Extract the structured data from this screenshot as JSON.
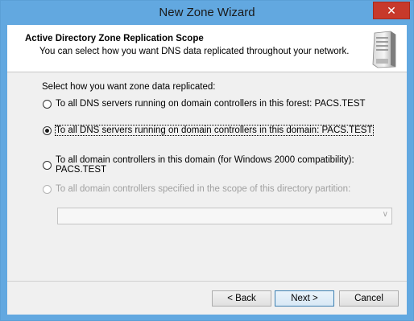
{
  "window": {
    "title": "New Zone Wizard",
    "close_glyph": "✕"
  },
  "header": {
    "title": "Active Directory Zone Replication Scope",
    "subtitle": "You can select how you want DNS data replicated throughout your network.",
    "icon": "server-icon"
  },
  "body": {
    "prompt": "Select how you want zone data replicated:",
    "options": [
      {
        "label": "To all DNS servers running on domain controllers in this forest: PACS.TEST",
        "selected": false,
        "enabled": true
      },
      {
        "label": "To all DNS servers running on domain controllers in this domain: PACS.TEST",
        "selected": true,
        "enabled": true
      },
      {
        "label": "To all domain controllers in this domain (for Windows 2000 compatibility): PACS.TEST",
        "selected": false,
        "enabled": true
      },
      {
        "label": "To all domain controllers specified in the scope of this directory partition:",
        "selected": false,
        "enabled": false
      }
    ],
    "partition_combo": {
      "value": "",
      "arrow_glyph": "∨"
    }
  },
  "buttons": {
    "back": "< Back",
    "next": "Next >",
    "cancel": "Cancel"
  }
}
